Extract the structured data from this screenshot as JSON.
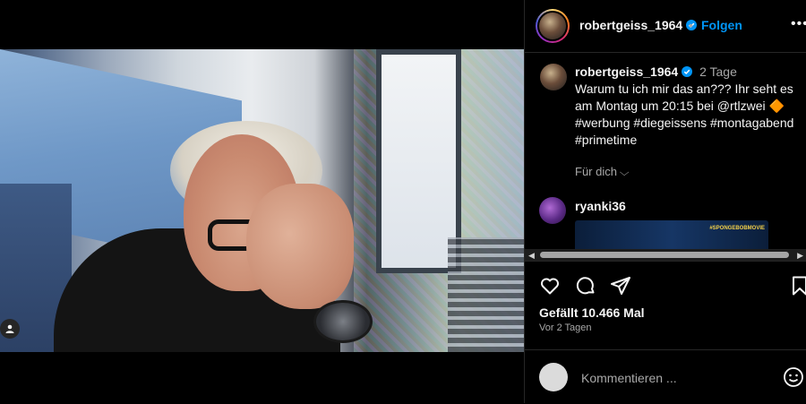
{
  "post": {
    "username": "robertgeiss_1964",
    "dot": "•",
    "follow_label": "Folgen",
    "more_label": "•••"
  },
  "caption": {
    "username": "robertgeiss_1964",
    "time": "2 Tage",
    "text": "Warum tu ich mir das an??? Ihr seht es am Montag um 20:15 bei @rtlzwei 🔶 #werbung #diegeissens #montagabend #primetime",
    "translate_label": "Für dich",
    "chevron": "⌵"
  },
  "comment": {
    "username": "ryanki36",
    "media_tag": "#SPONGEBOBMOVIE"
  },
  "scrollbar": {
    "left": "◀",
    "right": "▶"
  },
  "stats": {
    "likes": "Gefällt 10.466 Mal",
    "posted": "Vor 2 Tagen"
  },
  "comment_bar": {
    "placeholder": "Kommentieren ..."
  },
  "colors": {
    "accent": "#0095f6",
    "verified": "#0095f6",
    "background": "#000000",
    "divider": "#262626",
    "muted": "#a8a8a8"
  },
  "icons": [
    "user-tag-icon",
    "verified-icon",
    "more-icon",
    "chevron-down-icon",
    "heart-icon",
    "comment-icon",
    "share-icon",
    "bookmark-icon",
    "emoji-icon"
  ]
}
